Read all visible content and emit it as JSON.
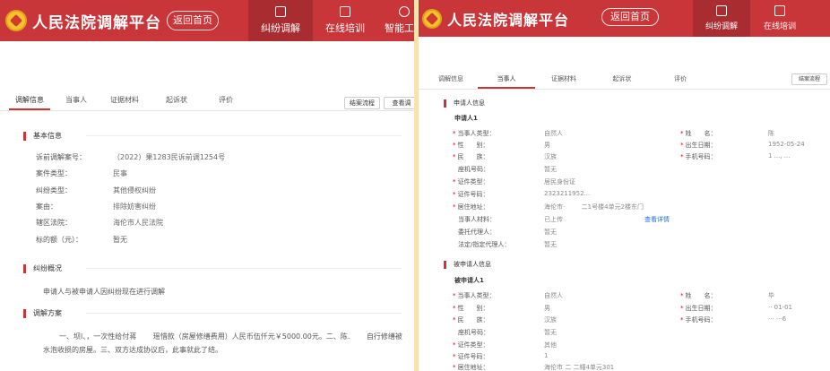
{
  "header": {
    "title": "人民法院调解平台",
    "home_btn": "返回首页",
    "nav": [
      {
        "label": "纠纷调解",
        "icon": "document-icon",
        "active": true
      },
      {
        "label": "在线培训",
        "icon": "book-icon",
        "active": false
      },
      {
        "label": "智能工具",
        "icon": "cube-icon",
        "active": false
      }
    ],
    "brand_color": "#c8363a"
  },
  "tabs": {
    "items": [
      "调解信息",
      "当事人",
      "证据材料",
      "起诉状",
      "评价"
    ],
    "btn_flow": "结案流程",
    "btn_view": "查看调"
  },
  "tabs_right": {
    "btn_flow": "结案流程"
  },
  "basic": {
    "title": "基本信息",
    "rows": [
      {
        "label": "诉前调解案号：",
        "value": "（2022）果1283民诉前调1254号"
      },
      {
        "label": "案件类型：",
        "value": "民事"
      },
      {
        "label": "纠纷类型：",
        "value": "其他侵权纠纷"
      },
      {
        "label": "案由：",
        "value": "排除妨害纠纷"
      },
      {
        "label": "辖区法院：",
        "value": "海伦市人民法院"
      },
      {
        "label": "标的额（元）：",
        "value": "暂无"
      }
    ]
  },
  "overview": {
    "title": "纠纷概况",
    "text": "申请人与被申请人因纠纷现在进行调解"
  },
  "plan": {
    "title": "调解方案",
    "text": "一、坝l、，一次性给付蒋 　　瑶惜款（房屋修缮费用）人民币伍仟元￥5000.00元。二、陈. 　　自行修缮被水泡收损的房屋。三、双方达成协议后，此事就此了结。"
  },
  "applicant": {
    "title": "申请人信息",
    "sub": "申请人1",
    "left": [
      {
        "label": "当事人类型：",
        "value": "自然人",
        "req": true
      },
      {
        "label": "性　　别：",
        "value": "男",
        "req": true
      },
      {
        "label": "民　　族：",
        "value": "汉族",
        "req": true
      },
      {
        "label": "座机号码：",
        "value": "暂无",
        "req": false
      },
      {
        "label": "证件类型：",
        "value": "居民身份证",
        "req": true
      },
      {
        "label": "证件号码：",
        "value": "2323211952...",
        "req": true
      },
      {
        "label": "居住地址：",
        "value": "海伦市· 　　 二1号楼4单元2楼东门",
        "req": true
      },
      {
        "label": "当事人材料：",
        "value": "已上传",
        "req": false,
        "link": "查看详情"
      },
      {
        "label": "委托代理人：",
        "value": "暂无",
        "req": false
      },
      {
        "label": "法定/指定代理人：",
        "value": "暂无",
        "req": false
      }
    ],
    "right": [
      {
        "label": "姓　　名：",
        "value": "陈 ",
        "req": true
      },
      {
        "label": "出生日期：",
        "value": "1952-05-24",
        "req": true
      },
      {
        "label": "手机号码：",
        "value": "1 ..., ...",
        "req": true
      }
    ]
  },
  "respondent": {
    "title": "被申请人信息",
    "sub": "被申请人1",
    "left": [
      {
        "label": "当事人类型：",
        "value": "自然人",
        "req": true
      },
      {
        "label": "性　　别：",
        "value": "男",
        "req": true
      },
      {
        "label": "民　　族：",
        "value": "汉族",
        "req": true
      },
      {
        "label": "座机号码：",
        "value": "暂无",
        "req": false
      },
      {
        "label": "证件类型：",
        "value": "其他",
        "req": true
      },
      {
        "label": "证件号码：",
        "value": "1",
        "req": true
      },
      {
        "label": "居住地址：",
        "value": "海伦市 二 二幢4单元301",
        "req": true
      }
    ],
    "right": [
      {
        "label": "姓　　名：",
        "value": "毕 ",
        "req": true
      },
      {
        "label": "出生日期：",
        "value": "·· 01-01",
        "req": true
      },
      {
        "label": "手机号码：",
        "value": "··· ···6",
        "req": true
      }
    ]
  }
}
